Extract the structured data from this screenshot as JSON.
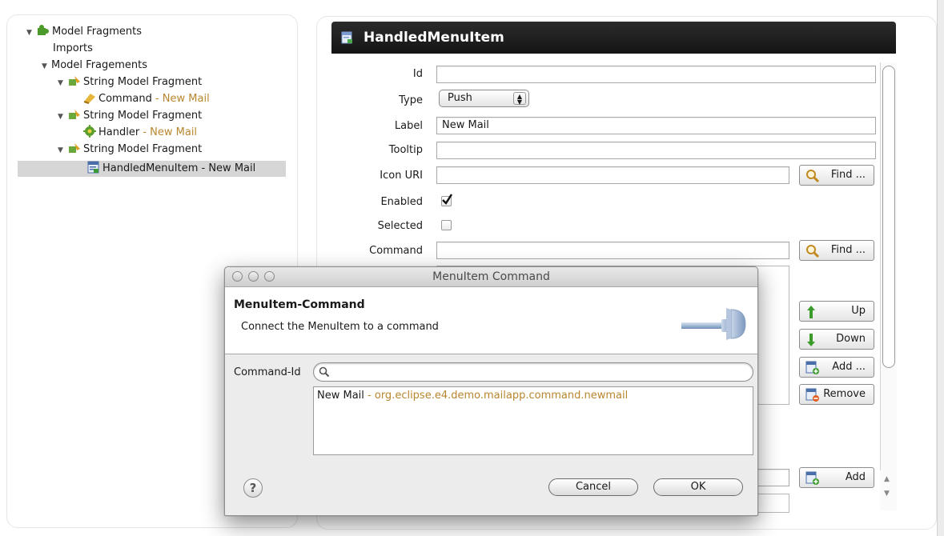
{
  "tree": {
    "items": [
      {
        "label": "Model Fragments",
        "sub": ""
      },
      {
        "label": "Imports",
        "sub": ""
      },
      {
        "label": "Model Fragements",
        "sub": ""
      },
      {
        "label": "String Model Fragment",
        "sub": ""
      },
      {
        "label": "Command",
        "sub": " - New Mail"
      },
      {
        "label": "String Model Fragment",
        "sub": ""
      },
      {
        "label": "Handler",
        "sub": " - New Mail"
      },
      {
        "label": "String Model Fragment",
        "sub": ""
      },
      {
        "label": "HandledMenuItem - New Mail",
        "sub": ""
      }
    ]
  },
  "editor": {
    "title": "HandledMenuItem",
    "fields": {
      "id_label": "Id",
      "id_value": "",
      "type_label": "Type",
      "type_value": "Push",
      "label_label": "Label",
      "label_value": "New Mail",
      "tooltip_label": "Tooltip",
      "tooltip_value": "",
      "icon_label": "Icon URI",
      "icon_value": "",
      "enabled_label": "Enabled",
      "enabled_checked": true,
      "selected_label": "Selected",
      "selected_checked": false,
      "command_label": "Command",
      "command_value": ""
    },
    "buttons": {
      "find": "Find ...",
      "up": "Up",
      "down": "Down",
      "add_more": "Add ...",
      "remove": "Remove",
      "add": "Add"
    }
  },
  "dialog": {
    "window_title": "MenuItem Command",
    "heading": "MenuItem-Command",
    "description": "Connect the MenuItem to a command",
    "search_label": "Command-Id",
    "search_value": "",
    "results": [
      {
        "name": "New Mail",
        "detail": " - org.eclipse.e4.demo.mailapp.command.newmail"
      }
    ],
    "cancel": "Cancel",
    "ok": "OK",
    "help": "?"
  },
  "colors": {
    "header_bg": "#1c1c1c",
    "secondary_text": "#b8862e",
    "selection": "#d6d6d6"
  }
}
